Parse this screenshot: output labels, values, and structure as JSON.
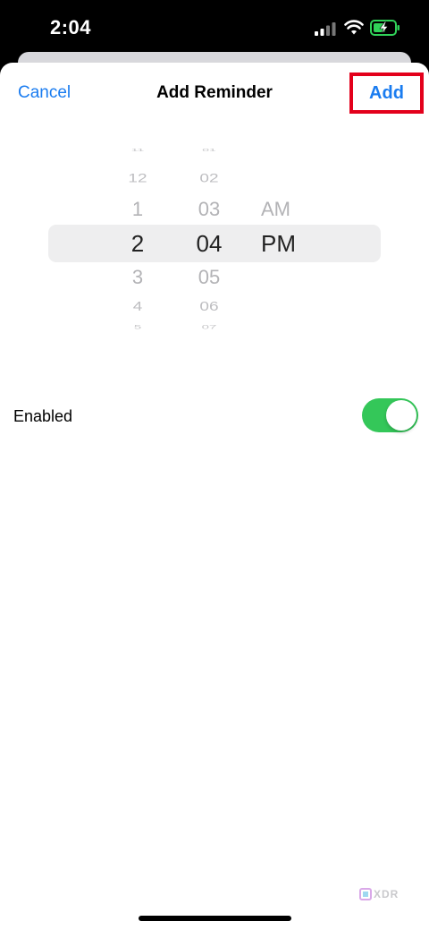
{
  "status_bar": {
    "time": "2:04",
    "icons": [
      "signal-icon",
      "wifi-icon",
      "battery-charging-icon"
    ],
    "battery_color": "#30d158"
  },
  "nav": {
    "cancel_label": "Cancel",
    "title": "Add Reminder",
    "add_label": "Add",
    "add_highlight_color": "#e3001b"
  },
  "picker": {
    "hours": [
      "11",
      "12",
      "1",
      "2",
      "3",
      "4",
      "5"
    ],
    "minutes": [
      "01",
      "02",
      "03",
      "04",
      "05",
      "06",
      "07"
    ],
    "periods": [
      "AM",
      "PM"
    ],
    "selected": {
      "hour": "2",
      "minute": "04",
      "period": "PM"
    }
  },
  "enabled": {
    "label": "Enabled",
    "value": true,
    "accent_color": "#34c759"
  },
  "watermark": {
    "text": "XDR",
    "icon": "xdr-logo-icon"
  }
}
